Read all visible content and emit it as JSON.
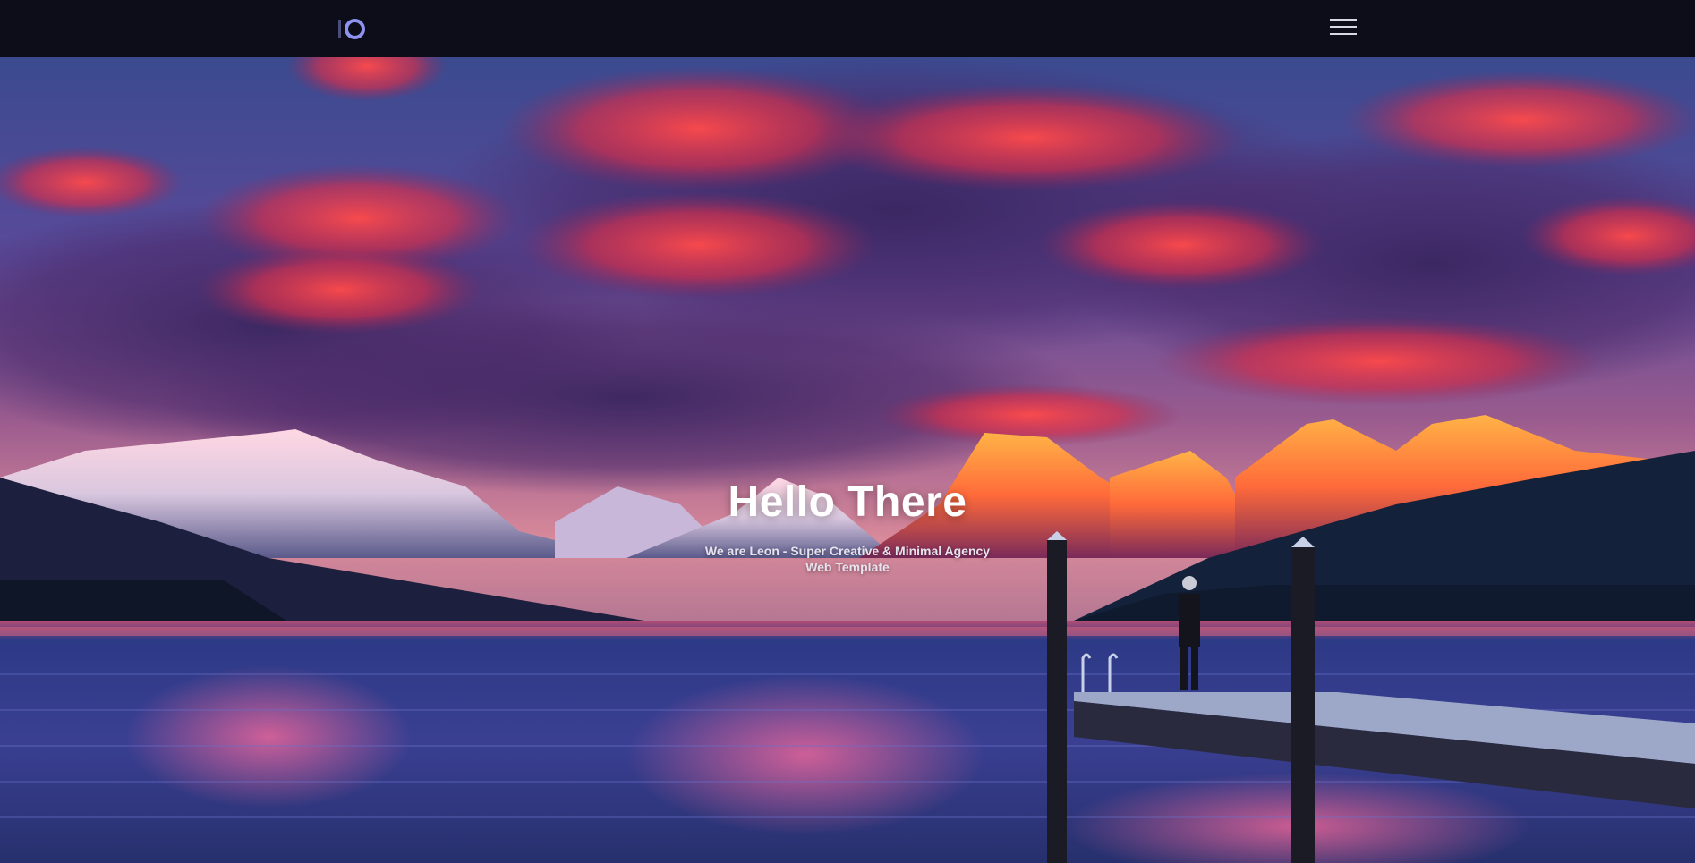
{
  "navbar": {
    "logo_label": "IO",
    "menu_icon": "hamburger-menu-icon"
  },
  "hero": {
    "title": "Hello There",
    "subtitle": "We are Leon - Super Creative & Minimal Agency Web Template",
    "background": "sunset-mountain-lake-pier-photo"
  },
  "colors": {
    "navbar_bg": "#0c0d18",
    "logo_accent": "#8f93f0",
    "title_text": "#ffffff"
  }
}
